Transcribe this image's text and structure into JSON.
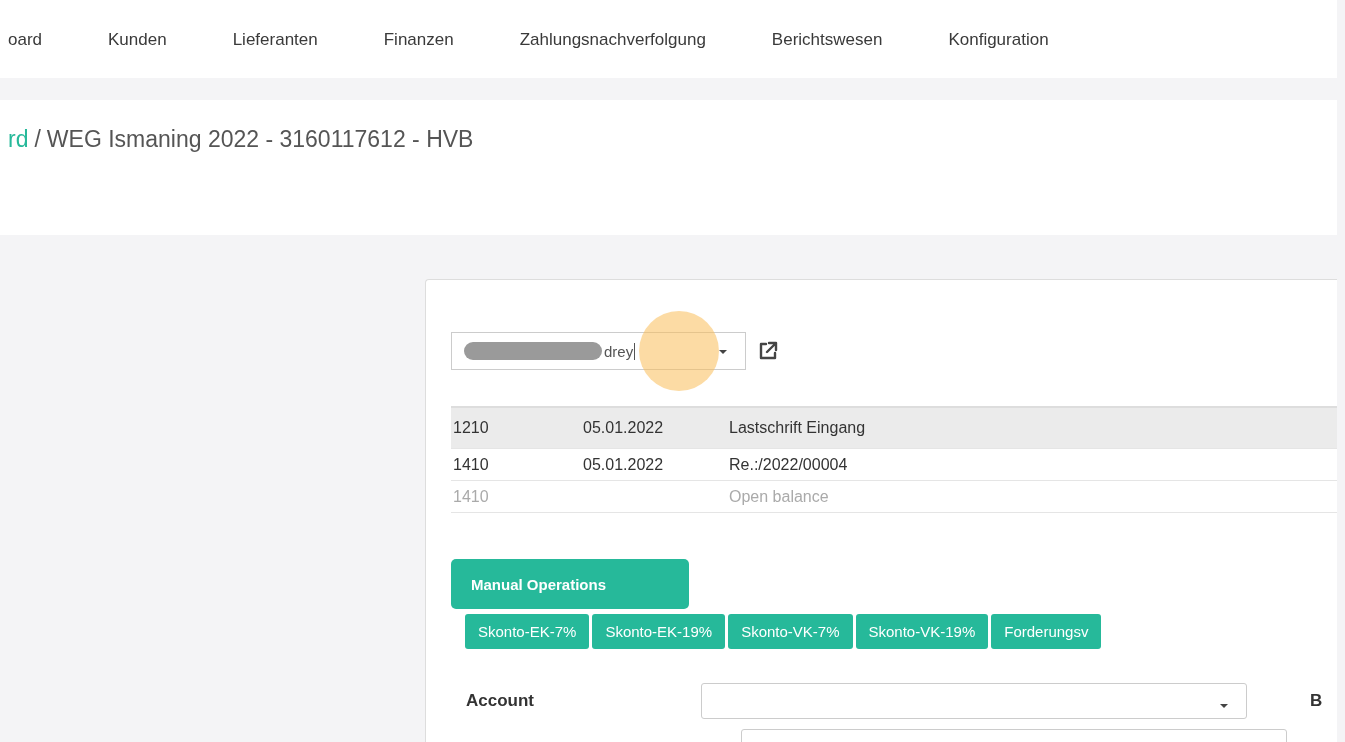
{
  "nav": {
    "items": [
      {
        "label": "oard",
        "selected": false
      },
      {
        "label": "Kunden",
        "selected": false
      },
      {
        "label": "Lieferanten",
        "selected": false
      },
      {
        "label": "Finanzen",
        "selected": false
      },
      {
        "label": "Zahlungsnachverfolgung",
        "selected": false
      },
      {
        "label": "Berichtswesen",
        "selected": false
      },
      {
        "label": "Konfiguration",
        "selected": false
      }
    ]
  },
  "breadcrumb": {
    "link": "rd",
    "separator": "/",
    "current": "WEG Ismaning 2022 - 3160117612 - HVB"
  },
  "partner_select": {
    "value": "drey",
    "redacted": true
  },
  "entries": [
    {
      "account": "1210",
      "date": "05.01.2022",
      "text": "Lastschrift Eingang",
      "muted": false,
      "selected": true
    },
    {
      "account": "1410",
      "date": "05.01.2022",
      "text": "Re.:/2022/00004",
      "muted": false,
      "selected": false
    },
    {
      "account": "1410",
      "text": "Open balance",
      "muted": true,
      "selected": false
    }
  ],
  "manual_operations": {
    "label": "Manual Operations"
  },
  "operation_tabs": [
    {
      "label": "Skonto-EK-7%"
    },
    {
      "label": "Skonto-EK-19%"
    },
    {
      "label": "Skonto-VK-7%"
    },
    {
      "label": "Skonto-VK-19%"
    },
    {
      "label": "Forderungsv"
    }
  ],
  "form": {
    "account_label": "Account",
    "next_column_label": "B"
  }
}
